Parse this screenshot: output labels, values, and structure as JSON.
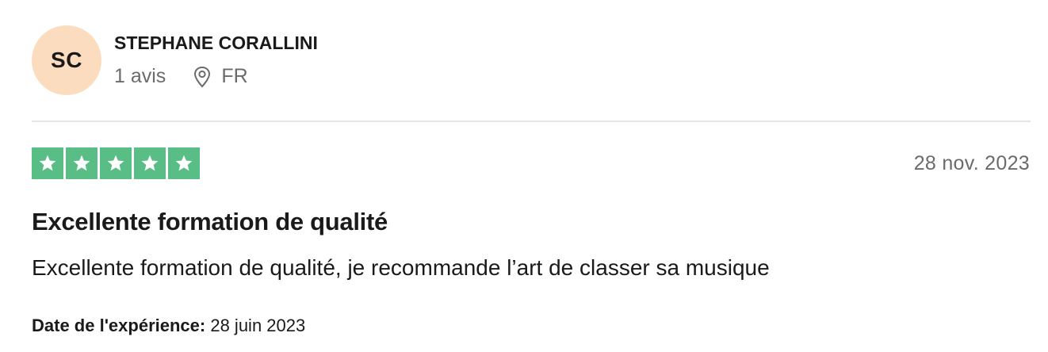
{
  "reviewer": {
    "initials": "SC",
    "name": "STEPHANE CORALLINI",
    "review_count": "1 avis",
    "country": "FR",
    "location_icon": "map-pin-icon",
    "avatar_color": "#fcdcbf"
  },
  "review": {
    "rating": 5,
    "rating_max": 5,
    "star_color": "#58be86",
    "date": "28 nov. 2023",
    "title": "Excellente formation de qualité",
    "body": "Excellente formation de qualité, je recommande l’art de classer sa musique",
    "experience_label": "Date de l'expérience:",
    "experience_date": "28 juin 2023"
  }
}
